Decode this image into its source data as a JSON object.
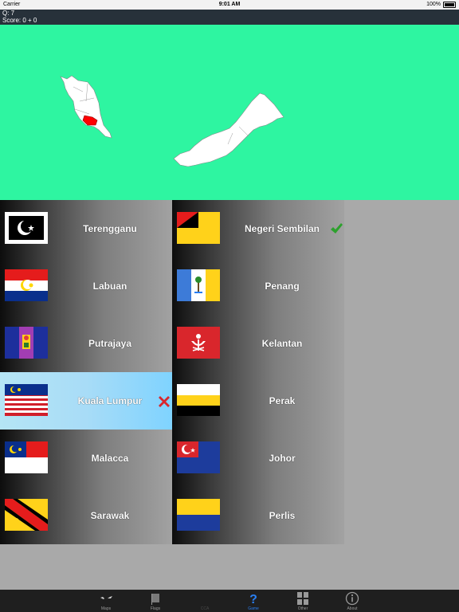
{
  "status": {
    "carrier": "Carrier",
    "time": "9:01 AM",
    "battery": "100%"
  },
  "info": {
    "question": "Q:    7",
    "score": "Score:    0 + 0"
  },
  "grid": {
    "left": [
      {
        "label": "Terengganu"
      },
      {
        "label": "Labuan"
      },
      {
        "label": "Putrajaya"
      },
      {
        "label": "Kuala Lumpur",
        "selected": true,
        "mark": "wrong"
      },
      {
        "label": "Malacca"
      },
      {
        "label": "Sarawak"
      }
    ],
    "right": [
      {
        "label": "Negeri Sembilan",
        "mark": "correct"
      },
      {
        "label": "Penang"
      },
      {
        "label": "Kelantan"
      },
      {
        "label": "Perak"
      },
      {
        "label": "Johor"
      },
      {
        "label": "Perlis"
      }
    ]
  },
  "tabs": [
    {
      "label": "Maps",
      "icon": "map-icon"
    },
    {
      "label": "Flags",
      "icon": "flag-icon"
    },
    {
      "label": "CCA",
      "icon": "blank-icon"
    },
    {
      "label": "Game",
      "icon": "question-icon",
      "active": true
    },
    {
      "label": "Other",
      "icon": "grid-icon"
    },
    {
      "label": "About",
      "icon": "info-icon"
    }
  ],
  "colors": {
    "map_bg": "#2ef5a1",
    "highlight_state": "#ff0000",
    "active_tab": "#2a7ff2"
  }
}
